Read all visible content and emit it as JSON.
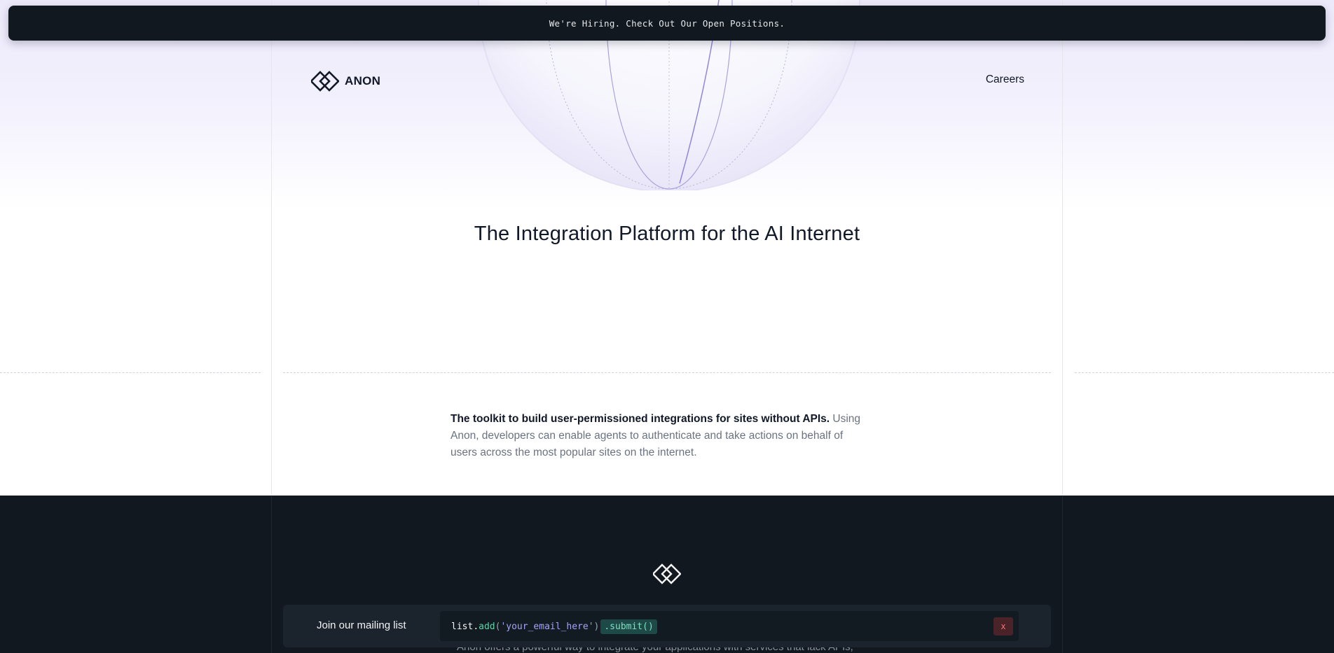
{
  "announcement": {
    "text": "We're Hiring. Check Out Our Open Positions."
  },
  "header": {
    "logo_text": "ANON",
    "nav": [
      {
        "label": "Careers"
      }
    ]
  },
  "hero": {
    "title": "The Integration Platform for the AI Internet"
  },
  "intro": {
    "lead": "The toolkit to build user-permissioned integrations for sites without APIs.",
    "body": " Using Anon, developers can enable agents to authenticate and take actions on behalf of users across the most popular sites on the internet."
  },
  "mailing_list": {
    "label": "Join our mailing list",
    "code_object": "list",
    "code_dot": ".",
    "code_method": "add",
    "code_open": "(",
    "code_quote_open": "'",
    "code_placeholder": "your_email_here",
    "code_quote_close": "'",
    "code_close": ")",
    "submit_label": ".submit()",
    "close_label": "x"
  },
  "next_section": {
    "peek_text": "Anon offers a powerful way to integrate your applications with services that lack APIs,"
  },
  "colors": {
    "dark_bg": "#111820",
    "accent_purple": "#a5a4f5",
    "accent_green": "#5fd3a8"
  }
}
